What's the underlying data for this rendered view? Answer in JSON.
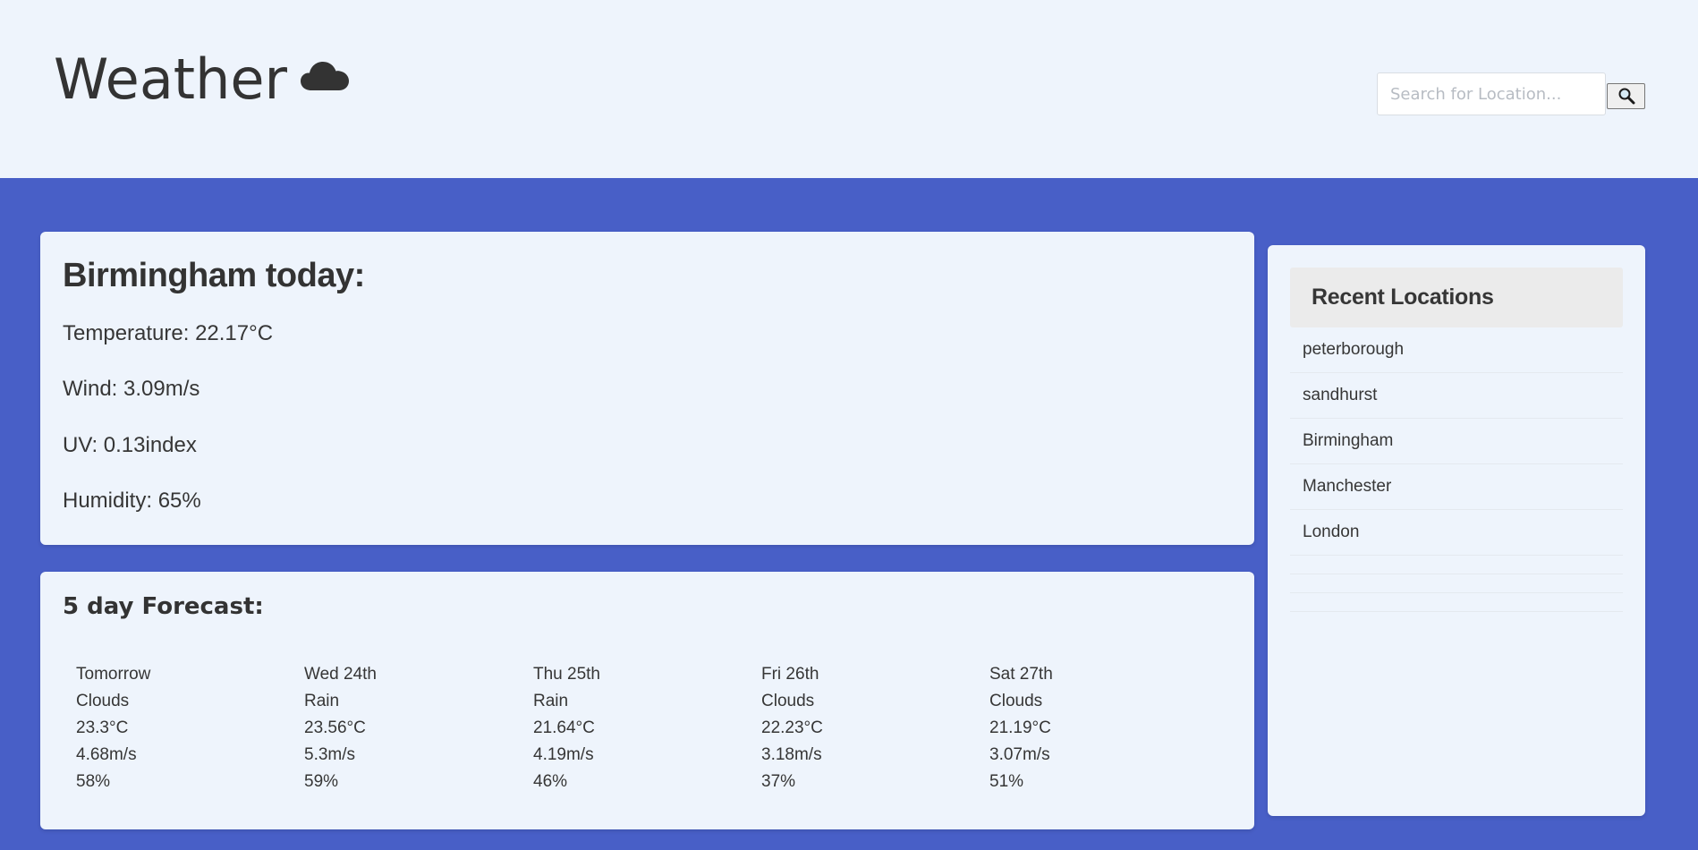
{
  "header": {
    "title": "Weather",
    "icon": "cloud-icon",
    "search": {
      "placeholder": "Search for Location...",
      "value": "",
      "button_icon": "search-icon"
    }
  },
  "today": {
    "title": "Birmingham today:",
    "temperature": "Temperature: 22.17°C",
    "wind": "Wind: 3.09m/s",
    "uv": "UV: 0.13index",
    "humidity": "Humidity: 65%"
  },
  "forecast": {
    "title": "5 day Forecast:",
    "days": [
      {
        "day": "Tomorrow",
        "condition": "Clouds",
        "temp": "23.3°C",
        "wind": "4.68m/s",
        "humidity": "58%"
      },
      {
        "day": "Wed 24th",
        "condition": "Rain",
        "temp": "23.56°C",
        "wind": "5.3m/s",
        "humidity": "59%"
      },
      {
        "day": "Thu 25th",
        "condition": "Rain",
        "temp": "21.64°C",
        "wind": "4.19m/s",
        "humidity": "46%"
      },
      {
        "day": "Fri 26th",
        "condition": "Clouds",
        "temp": "22.23°C",
        "wind": "3.18m/s",
        "humidity": "37%"
      },
      {
        "day": "Sat 27th",
        "condition": "Clouds",
        "temp": "21.19°C",
        "wind": "3.07m/s",
        "humidity": "51%"
      }
    ]
  },
  "recent": {
    "heading": "Recent Locations",
    "items": [
      "peterborough",
      "sandhurst",
      "Birmingham",
      "Manchester",
      "London"
    ]
  },
  "colors": {
    "page_background": "#485fc7",
    "card_background": "#eef4fc",
    "text": "#333333"
  }
}
